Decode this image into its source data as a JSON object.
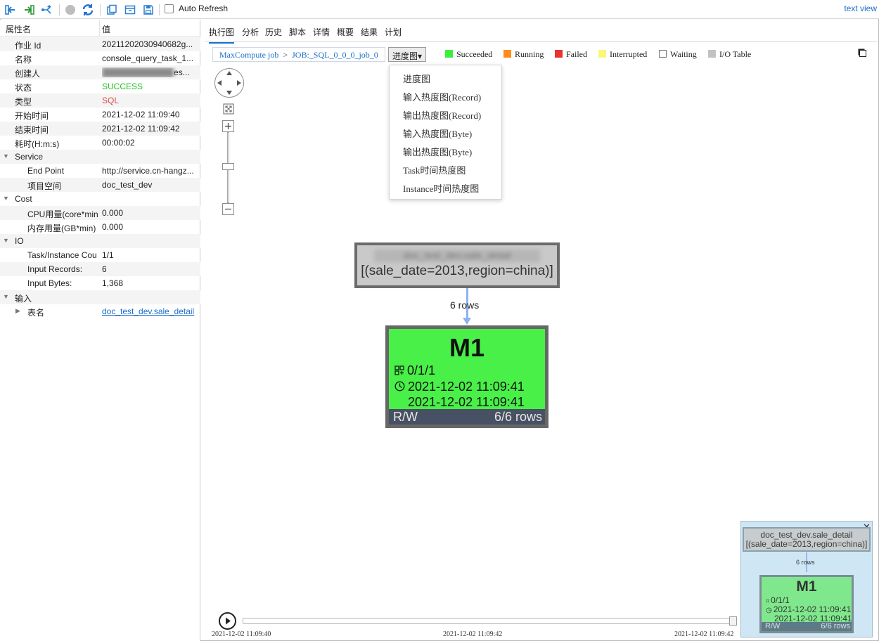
{
  "toolbar": {
    "icons": [
      "back-icon",
      "forward-icon",
      "graph-icon",
      "stop-icon",
      "refresh-icon",
      "copy-icon",
      "open-icon",
      "save-icon"
    ],
    "auto_refresh_label": "Auto Refresh",
    "auto_refresh_checked": false,
    "text_view_label": "text view"
  },
  "properties": {
    "header_name": "属性名",
    "header_value": "值",
    "rows": [
      {
        "key": "作业 Id",
        "value": "20211202030940682g..."
      },
      {
        "key": "名称",
        "value": "console_query_task_1..."
      },
      {
        "key": "创建人",
        "value": "es..."
      },
      {
        "key": "状态",
        "value": "SUCCESS",
        "color": "#22c322"
      },
      {
        "key": "类型",
        "value": "SQL",
        "color": "#d84a4a"
      },
      {
        "key": "开始时间",
        "value": "2021-12-02 11:09:40"
      },
      {
        "key": "结束时间",
        "value": "2021-12-02 11:09:42"
      },
      {
        "key": "耗时(H:m:s)",
        "value": "00:00:02"
      },
      {
        "key": "Service",
        "value": "",
        "group": true
      },
      {
        "key": "End Point",
        "value": "http://service.cn-hangz..."
      },
      {
        "key": "项目空间",
        "value": "doc_test_dev"
      },
      {
        "key": "Cost",
        "value": "",
        "group": true
      },
      {
        "key": "CPU用量(core*min",
        "value": "0.000"
      },
      {
        "key": "内存用量(GB*min)",
        "value": "0.000"
      },
      {
        "key": "IO",
        "value": "",
        "group": true
      },
      {
        "key": "Task/Instance Cou",
        "value": "1/1"
      },
      {
        "key": "Input Records:",
        "value": "6"
      },
      {
        "key": "Input Bytes:",
        "value": "1,368"
      },
      {
        "key": "输入",
        "value": "",
        "group": true
      },
      {
        "key": "表名",
        "value": "doc_test_dev.sale_detail",
        "link": true
      }
    ]
  },
  "tabs": [
    "执行图",
    "分析",
    "历史",
    "脚本",
    "详情",
    "概要",
    "结果",
    "计划"
  ],
  "active_tab": "执行图",
  "breadcrumb": {
    "root": "MaxCompute job",
    "sep": ">",
    "job": "JOB:_SQL_0_0_0_job_0"
  },
  "view_selector": {
    "label": "进度图▾"
  },
  "legend": [
    {
      "label": "Succeeded",
      "color": "#3cef3c"
    },
    {
      "label": "Running",
      "color": "#ff8c1a"
    },
    {
      "label": "Failed",
      "color": "#e8332e"
    },
    {
      "label": "Interrupted",
      "color": "#fbf67c"
    },
    {
      "label": "Waiting",
      "color": "#ffffff"
    },
    {
      "label": "I/O Table",
      "color": "#c2c2c2"
    }
  ],
  "view_menu": [
    "进度图",
    "输入热度图(Record)",
    "输出热度图(Record)",
    "输入热度图(Byte)",
    "输出热度图(Byte)",
    "Task时间热度图",
    "Instance时间热度图"
  ],
  "graph": {
    "source": {
      "title": "doc_test_dev.sale_detail",
      "partition": "[(sale_date=2013,region=china)]"
    },
    "edge_label": "6 rows",
    "task": {
      "name": "M1",
      "instances": "0/1/1",
      "start": "2021-12-02 11:09:41",
      "end": "2021-12-02 11:09:41",
      "io": "R/W",
      "rows": "6/6 rows"
    }
  },
  "timeline": {
    "labels": [
      "2021-12-02 11:09:40",
      "2021-12-02 11:09:42",
      "2021-12-02 11:09:42"
    ],
    "progress": 1.0
  },
  "minimap": {
    "source_title": "doc_test_dev.sale_detail",
    "source_partition": "[(sale_date=2013,region=china)]",
    "edge_label": "6 rows",
    "task_name": "M1",
    "instances": "0/1/1",
    "start": "2021-12-02 11:09:41",
    "end": "2021-12-02 11:09:41",
    "io": "R/W",
    "rows": "6/6 rows",
    "close": "✕"
  }
}
